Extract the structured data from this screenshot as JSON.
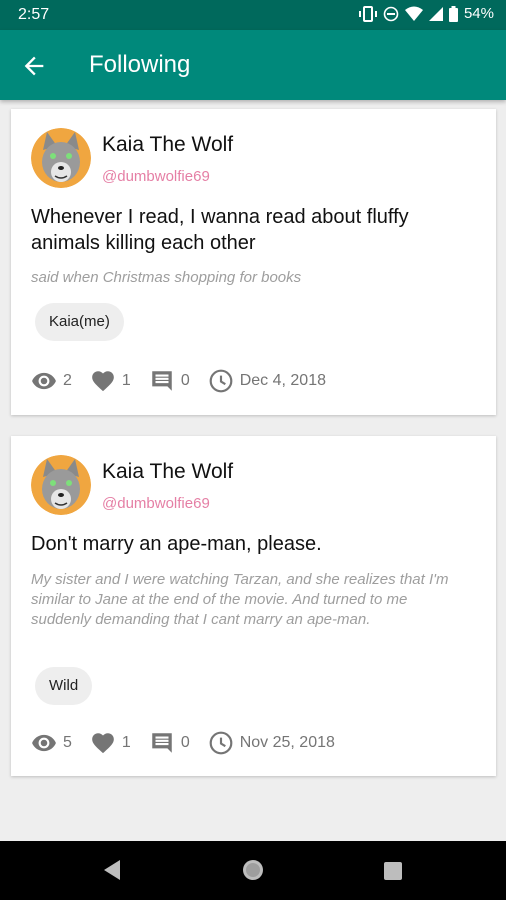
{
  "status": {
    "time": "2:57",
    "battery": "54%"
  },
  "header": {
    "title": "Following"
  },
  "posts": [
    {
      "author": "Kaia The Wolf",
      "handle": "@dumbwolfie69",
      "text": "Whenever I read, I wanna read about fluffy animals killing each other",
      "context": "said when Christmas shopping for books",
      "tag": "Kaia(me)",
      "views": "2",
      "likes": "1",
      "comments": "0",
      "date": "Dec 4, 2018"
    },
    {
      "author": "Kaia The Wolf",
      "handle": "@dumbwolfie69",
      "text": "Don't marry an ape-man, please.",
      "context": "My sister and I were watching Tarzan, and she realizes that I'm similar to Jane at the end of the movie. And turned to me suddenly demanding that I cant marry an ape-man.",
      "tag": "Wild",
      "views": "5",
      "likes": "1",
      "comments": "0",
      "date": "Nov 25, 2018"
    }
  ],
  "colors": {
    "status_bar": "#00695c",
    "app_bar": "#00897b",
    "handle": "#e57fa5"
  }
}
